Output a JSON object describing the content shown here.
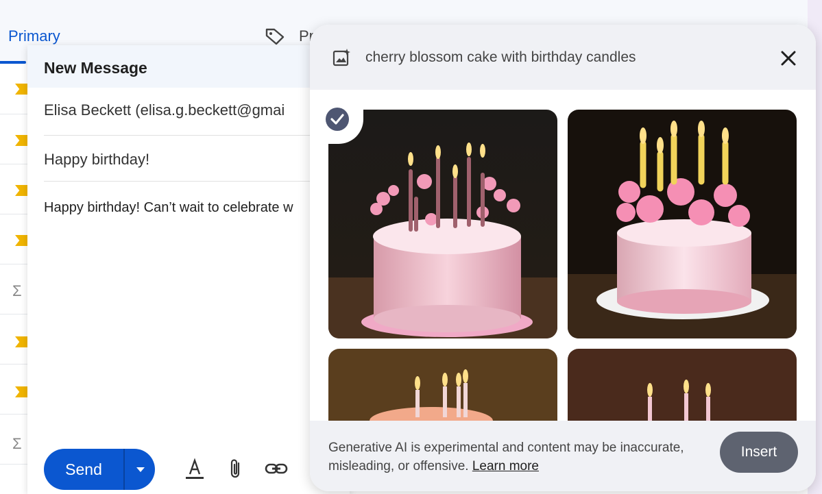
{
  "inbox": {
    "tab_primary": "Primary",
    "tab_promotions": "Pr"
  },
  "compose": {
    "title": "New Message",
    "to": "Elisa Beckett (elisa.g.beckett@gmai",
    "subject": "Happy birthday!",
    "body": "Happy birthday! Can’t wait to celebrate w",
    "send_label": "Send"
  },
  "image_panel": {
    "prompt": "cherry blossom cake with birthday candles",
    "disclaimer": "Generative AI is experimental and content may be inaccurate, misleading, or offensive.",
    "learn_more": "Learn more",
    "insert_label": "Insert",
    "selected_image": 1
  },
  "colors": {
    "accent": "#0b57d0",
    "insert": "#5e6370",
    "star_marker": "#f0b400"
  }
}
